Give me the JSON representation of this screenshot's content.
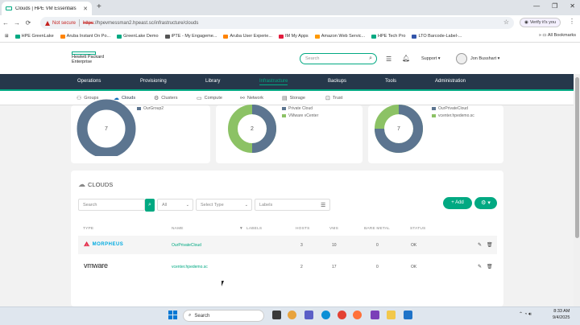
{
  "browser": {
    "tab_title": "Clouds | HPE VM Essentials",
    "new_tab": "+",
    "not_secure": "Not secure",
    "url_scheme": "https",
    "url_rest": "://hpevmessman2.hpeast.sc/infrastructure/clouds",
    "verify": "Verify it's you",
    "all_bookmarks": "All Bookmarks",
    "bookmarks": [
      {
        "label": "HPE GreenLake",
        "color": "#01a982"
      },
      {
        "label": "Aruba Instant On Po...",
        "color": "#ff8300"
      },
      {
        "label": "GreenLake Demo",
        "color": "#01a982"
      },
      {
        "label": "iPTE - My Engageme...",
        "color": "#555555"
      },
      {
        "label": "Aruba User Experie...",
        "color": "#ff8300"
      },
      {
        "label": "IM My Apps",
        "color": "#e31c3d"
      },
      {
        "label": "Amazon Web Servic...",
        "color": "#ff9900"
      },
      {
        "label": "HPE Tech Pro",
        "color": "#01a982"
      },
      {
        "label": "LTO Barcode-Label-...",
        "color": "#3355aa"
      }
    ]
  },
  "header": {
    "logo_line1": "Hewlett Packard",
    "logo_line2": "Enterprise",
    "search_placeholder": "Search",
    "support": "Support ▾",
    "user": "Jon Busshart ▾"
  },
  "mainnav": [
    "Operations",
    "Provisioning",
    "Library",
    "Infrastructure",
    "Backups",
    "Tools",
    "Administration"
  ],
  "subnav": [
    {
      "label": "Groups",
      "icon": "⚇"
    },
    {
      "label": "Clouds",
      "icon": "☁"
    },
    {
      "label": "Clusters",
      "icon": "⚙"
    },
    {
      "label": "Compute",
      "icon": "▭"
    },
    {
      "label": "Network",
      "icon": "⚯"
    },
    {
      "label": "Storage",
      "icon": "▤"
    },
    {
      "label": "Trust",
      "icon": "⊡"
    }
  ],
  "summary": [
    {
      "value": "7",
      "legend": [
        {
          "label": "OurGroup2",
          "color": "#5c7590"
        }
      ],
      "fraction": 1.0
    },
    {
      "value": "2",
      "legend": [
        {
          "label": "Private Cloud",
          "color": "#5c7590"
        },
        {
          "label": "VMware vCenter",
          "color": "#8cc265"
        }
      ],
      "fraction": 0.5
    },
    {
      "value": "7",
      "legend": [
        {
          "label": "OurPrivateCloud",
          "color": "#5c7590"
        },
        {
          "label": "vcenter.hpedemo.sc",
          "color": "#8cc265"
        }
      ],
      "fraction": 0.7
    }
  ],
  "clouds": {
    "title": "CLOUDS",
    "search_placeholder": "Search",
    "filter_all": "All",
    "filter_type": "Select Type",
    "filter_labels": "Labels",
    "add": "+ Add",
    "columns": [
      "TYPE",
      "NAME",
      "LABELS",
      "HOSTS",
      "VMS",
      "BARE METAL",
      "STATUS"
    ],
    "rows": [
      {
        "type": "MORPHEUS",
        "name": "OurPrivateCloud",
        "hosts": "3",
        "vms": "10",
        "bare_metal": "0",
        "status": "OK"
      },
      {
        "type": "vmware",
        "name": "vcenter.hpedemo.sc",
        "hosts": "2",
        "vms": "17",
        "bare_metal": "0",
        "status": "OK"
      }
    ]
  },
  "taskbar": {
    "search": "Search",
    "time": "8:33 AM",
    "date": "9/4/2025"
  }
}
